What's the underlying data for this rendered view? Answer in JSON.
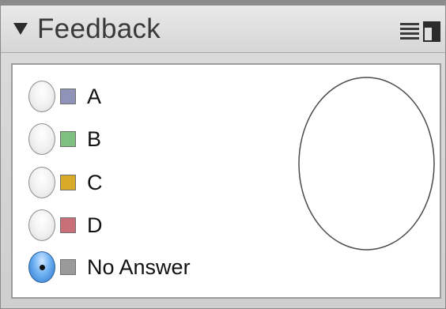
{
  "panel": {
    "title": "Feedback",
    "icons": {
      "collapse": "collapse-triangle-icon",
      "menu": "panel-menu-icon",
      "dock": "dock-icon"
    }
  },
  "options": [
    {
      "label": "A",
      "color": "#8f93b8",
      "selected": false
    },
    {
      "label": "B",
      "color": "#7fbf7f",
      "selected": false
    },
    {
      "label": "C",
      "color": "#d9a928",
      "selected": false
    },
    {
      "label": "D",
      "color": "#c86f78",
      "selected": false
    },
    {
      "label": "No Answer",
      "color": "#9a9a9a",
      "selected": true
    }
  ],
  "pie": {
    "fill": "#ffffff",
    "stroke": "#4a4a4a"
  }
}
